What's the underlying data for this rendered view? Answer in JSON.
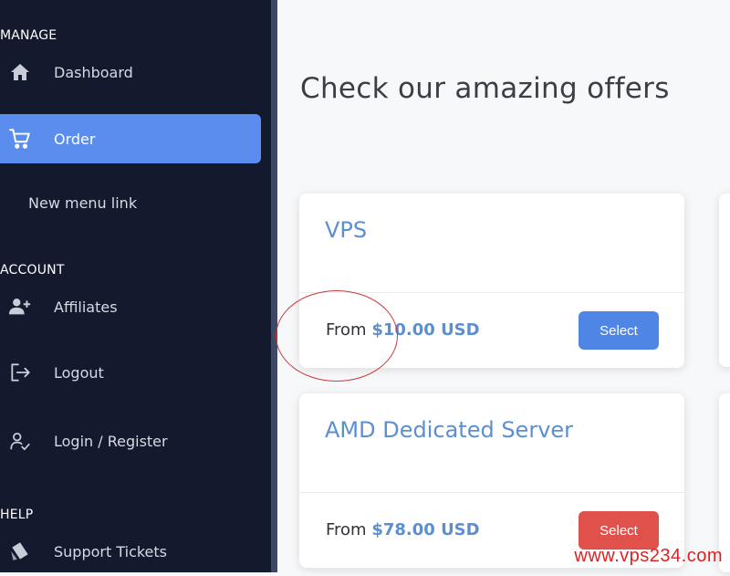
{
  "sidebar": {
    "sections": [
      {
        "title": "MANAGE"
      },
      {
        "title": "ACCOUNT"
      },
      {
        "title": "HELP"
      }
    ],
    "items": [
      {
        "label": "Dashboard",
        "icon": "home-icon"
      },
      {
        "label": "Order",
        "icon": "cart-icon",
        "active": true
      },
      {
        "label": "New menu link"
      },
      {
        "label": "Affiliates",
        "icon": "add-user-icon"
      },
      {
        "label": "Logout",
        "icon": "logout-icon"
      },
      {
        "label": "Login / Register",
        "icon": "user-check-icon"
      },
      {
        "label": "Support Tickets",
        "icon": "ticket-icon"
      }
    ]
  },
  "main": {
    "title": "Check our amazing offers",
    "products": [
      {
        "name": "VPS",
        "from_label": "From",
        "price": "$10.00 USD",
        "button_label": "Select",
        "button_color": "#4f86e6"
      },
      {
        "name": "AMD Dedicated Server",
        "from_label": "From",
        "price": "$78.00 USD",
        "button_label": "Select",
        "button_color": "#e0514b"
      }
    ]
  },
  "watermark": "www.vps234.com",
  "colors": {
    "sidebar_bg": "#141a2e",
    "active_item": "#5b8def",
    "product_name": "#5b8fd1",
    "annotation": "#c83a3a"
  }
}
